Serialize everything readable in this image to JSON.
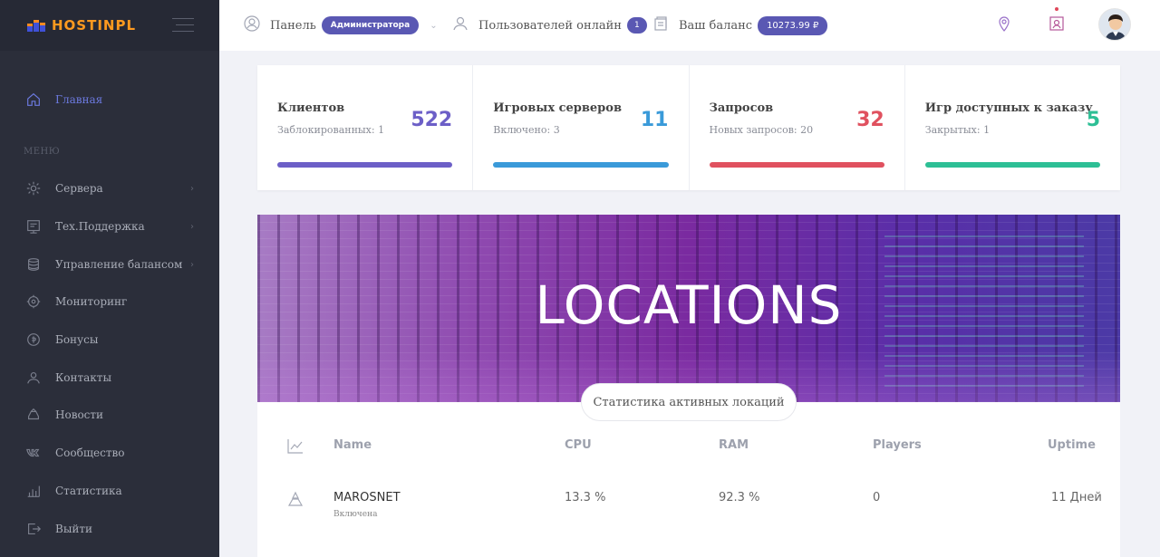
{
  "brand": {
    "name": "HOSTINPL",
    "logo_bar_colors": [
      "#3f51d8",
      "#ff8a1f"
    ]
  },
  "topbar": {
    "panel_label": "Панель",
    "role_badge": "Администратора",
    "users_online_label": "Пользователей онлайн",
    "users_online_count": "1",
    "balance_label": "Ваш баланс",
    "balance_value": "10273.99 ₽",
    "icons": [
      "user-circle-icon",
      "users-icon",
      "wallet-icon",
      "location-pin-icon",
      "contact-book-icon"
    ]
  },
  "sidebar": {
    "menu_caption": "МЕНЮ",
    "items": [
      {
        "label": "Главная",
        "icon": "home-icon",
        "active": true,
        "arrow": ""
      },
      {
        "label": "Сервера",
        "icon": "server-icon",
        "arrow": "›"
      },
      {
        "label": "Тех.Поддержка",
        "icon": "support-icon",
        "arrow": "›"
      },
      {
        "label": "Управление балансом",
        "icon": "coins-icon",
        "arrow": "›"
      },
      {
        "label": "Мониторинг",
        "icon": "monitoring-icon",
        "arrow": ""
      },
      {
        "label": "Бонусы",
        "icon": "bonus-icon",
        "arrow": ""
      },
      {
        "label": "Контакты",
        "icon": "contacts-icon",
        "arrow": ""
      },
      {
        "label": "Новости",
        "icon": "news-icon",
        "arrow": ""
      },
      {
        "label": "Сообщество",
        "icon": "vk-icon",
        "arrow": ""
      },
      {
        "label": "Статистика",
        "icon": "stats-icon",
        "arrow": ""
      },
      {
        "label": "Выйти",
        "icon": "logout-icon",
        "arrow": ""
      }
    ]
  },
  "stats": [
    {
      "title": "Клиентов",
      "sub": "Заблокированных: 1",
      "value": "522",
      "color": "#6c5fc7"
    },
    {
      "title": "Игровых серверов",
      "sub": "Включено: 3",
      "value": "11",
      "color": "#3a9ad9"
    },
    {
      "title": "Запросов",
      "sub": "Новых запросов: 20",
      "value": "32",
      "color": "#e0515f"
    },
    {
      "title": "Игр доступных к заказу",
      "sub": "Закрытых: 1",
      "value": "5",
      "color": "#2dbf95"
    }
  ],
  "banner": {
    "title": "LOCATIONS"
  },
  "locations": {
    "tab_label": "Статистика активных локаций",
    "headers": {
      "name": "Name",
      "cpu": "CPU",
      "ram": "RAM",
      "players": "Players",
      "uptime": "Uptime"
    },
    "rows": [
      {
        "name": "MAROSNET",
        "status": "Включена",
        "cpu": "13.3 %",
        "ram": "92.3 %",
        "players": "0",
        "uptime": "11 Дней"
      }
    ]
  }
}
